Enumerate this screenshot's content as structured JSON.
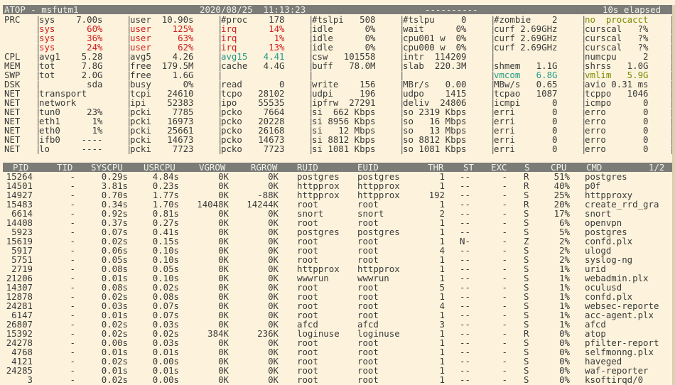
{
  "title": {
    "left": "ATOP - msfutm1",
    "datetime": "2020/08/25  11:13:23",
    "dashes": "----------",
    "elapsed": "10s elapsed"
  },
  "sys_rows": [
    [
      "PRC",
      "sys    7.00s",
      "user  10.90s",
      "#proc    178",
      "#tslpi   508",
      "#tslpu     0",
      "#zombie    2",
      "no  procacct"
    ],
    [
      "",
      "sys      60%",
      "user    125%",
      "irq      14%",
      "idle      0%",
      "wait      0%",
      "curf 2.69GHz",
      "curscal   ?%"
    ],
    [
      "",
      "sys      36%",
      "user     63%",
      "irq       1%",
      "idle      0%",
      "cpu001 w  0%",
      "curf 2.69GHz",
      "curscal   ?%"
    ],
    [
      "",
      "sys      24%",
      "user     62%",
      "irq      13%",
      "idle      0%",
      "cpu000 w  0%",
      "curf 2.69GHz",
      "curscal   ?%"
    ],
    [
      "CPL",
      "avg1    5.28",
      "avg5    4.26",
      "avg15   4.41",
      "csw   101558",
      "intr  114209",
      "",
      "numcpu     2"
    ],
    [
      "MEM",
      "tot     7.8G",
      "free  179.5M",
      "cache   4.4G",
      "buff   78.0M",
      "slab  220.3M",
      "shmem   1.1G",
      "shrss   1.0G"
    ],
    [
      "SWP",
      "tot     2.0G",
      "free    1.6G",
      "",
      "",
      "",
      "vmcom   6.8G",
      "vmlim   5.9G"
    ],
    [
      "DSK",
      "         sda",
      "busy      0%",
      "read       0",
      "write    156",
      "MBr/s   0.00",
      "MBw/s   0.65",
      "avio 0.31 ms"
    ],
    [
      "NET",
      "transport",
      "tcpi   24610",
      "tcpo   28102",
      "udpi     196",
      "udpo    1415",
      "tcpao   1087",
      "tcppo   1046"
    ],
    [
      "NET",
      "network",
      "ipi    52383",
      "ipo    55535",
      "ipfrw  27291",
      "deliv  24806",
      "icmpi      0",
      "icmpo      0"
    ],
    [
      "NET",
      "tun0     23%",
      "pcki    7785",
      "pcko    7664",
      "si  662 Kbps",
      "so 2319 Kbps",
      "erri       0",
      "erro       0"
    ],
    [
      "NET",
      "eth1      1%",
      "pcki   16973",
      "pcko   20228",
      "si 8956 Kbps",
      "so   16 Mbps",
      "erri       0",
      "erro       0"
    ],
    [
      "NET",
      "eth0      1%",
      "pcki   25661",
      "pcko   26168",
      "si   12 Mbps",
      "so   13 Mbps",
      "erri       0",
      "erro       0"
    ],
    [
      "NET",
      "ifb0    ----",
      "pcki   14673",
      "pcko   14673",
      "si 8812 Kbps",
      "so 8812 Kbps",
      "erri       0",
      "erro       0"
    ],
    [
      "NET",
      "lo      ----",
      "pcki    7723",
      "pcko    7723",
      "si 1081 Kbps",
      "so 1081 Kbps",
      "erri       0",
      "erro       0"
    ]
  ],
  "proc_header": [
    "PID",
    "TID",
    "SYSCPU",
    "USRCPU",
    "VGROW",
    "RGROW",
    "RUID",
    "EUID",
    "THR",
    "ST",
    "EXC",
    "S",
    "CPU",
    "CMD",
    "1/2"
  ],
  "processes": [
    [
      "15264",
      "-",
      "0.29s",
      "4.84s",
      "0K",
      "0K",
      "postgres",
      "postgres",
      "1",
      "--",
      "-",
      "R",
      "51%",
      "postgres"
    ],
    [
      "14501",
      "-",
      "3.81s",
      "0.23s",
      "0K",
      "0K",
      "httpprox",
      "httpprox",
      "1",
      "--",
      "-",
      "R",
      "40%",
      "p0f"
    ],
    [
      "14927",
      "-",
      "0.70s",
      "1.77s",
      "0K",
      "-88K",
      "httpprox",
      "httpprox",
      "192",
      "--",
      "-",
      "S",
      "25%",
      "httpproxy"
    ],
    [
      "15483",
      "-",
      "0.34s",
      "1.70s",
      "14048K",
      "14244K",
      "root",
      "root",
      "1",
      "--",
      "-",
      "R",
      "20%",
      "create_rrd_gra"
    ],
    [
      "6614",
      "-",
      "0.92s",
      "0.81s",
      "0K",
      "0K",
      "snort",
      "snort",
      "2",
      "--",
      "-",
      "S",
      "17%",
      "snort"
    ],
    [
      "14408",
      "-",
      "0.37s",
      "0.27s",
      "0K",
      "0K",
      "root",
      "root",
      "1",
      "--",
      "-",
      "S",
      "6%",
      "openvpn"
    ],
    [
      "5923",
      "-",
      "0.07s",
      "0.41s",
      "0K",
      "0K",
      "postgres",
      "postgres",
      "1",
      "--",
      "-",
      "S",
      "5%",
      "postgres"
    ],
    [
      "15619",
      "-",
      "0.02s",
      "0.15s",
      "0K",
      "0K",
      "root",
      "root",
      "1",
      "N-",
      "-",
      "Z",
      "2%",
      "confd.plx"
    ],
    [
      "5917",
      "-",
      "0.06s",
      "0.10s",
      "0K",
      "0K",
      "root",
      "root",
      "4",
      "--",
      "-",
      "S",
      "2%",
      "ulogd"
    ],
    [
      "5751",
      "-",
      "0.05s",
      "0.10s",
      "0K",
      "0K",
      "root",
      "root",
      "1",
      "--",
      "-",
      "S",
      "2%",
      "syslog-ng"
    ],
    [
      "2719",
      "-",
      "0.08s",
      "0.05s",
      "0K",
      "0K",
      "httpprox",
      "httpprox",
      "1",
      "--",
      "-",
      "S",
      "1%",
      "urid"
    ],
    [
      "21206",
      "-",
      "0.01s",
      "0.10s",
      "0K",
      "0K",
      "wwwrun",
      "wwwrun",
      "1",
      "--",
      "-",
      "S",
      "1%",
      "webadmin.plx"
    ],
    [
      "14307",
      "-",
      "0.08s",
      "0.02s",
      "0K",
      "0K",
      "root",
      "root",
      "5",
      "--",
      "-",
      "S",
      "1%",
      "oculusd"
    ],
    [
      "12878",
      "-",
      "0.02s",
      "0.08s",
      "0K",
      "0K",
      "root",
      "root",
      "1",
      "--",
      "-",
      "S",
      "1%",
      "confd.plx"
    ],
    [
      "24281",
      "-",
      "0.03s",
      "0.07s",
      "0K",
      "0K",
      "root",
      "root",
      "4",
      "--",
      "-",
      "S",
      "1%",
      "websec-reporte"
    ],
    [
      "6147",
      "-",
      "0.01s",
      "0.07s",
      "0K",
      "0K",
      "root",
      "root",
      "1",
      "--",
      "-",
      "S",
      "1%",
      "acc-agent.plx"
    ],
    [
      "26807",
      "-",
      "0.02s",
      "0.03s",
      "0K",
      "0K",
      "afcd",
      "afcd",
      "3",
      "--",
      "-",
      "S",
      "1%",
      "afcd"
    ],
    [
      "15392",
      "-",
      "0.02s",
      "0.02s",
      "384K",
      "236K",
      "loginuse",
      "loginuse",
      "1",
      "--",
      "-",
      "R",
      "0%",
      "atop"
    ],
    [
      "24278",
      "-",
      "0.00s",
      "0.03s",
      "0K",
      "0K",
      "root",
      "root",
      "1",
      "--",
      "-",
      "S",
      "0%",
      "pfilter-report"
    ],
    [
      "4768",
      "-",
      "0.01s",
      "0.01s",
      "0K",
      "0K",
      "root",
      "root",
      "1",
      "--",
      "-",
      "S",
      "0%",
      "selfmonng.plx"
    ],
    [
      "4121",
      "-",
      "0.02s",
      "0.00s",
      "0K",
      "0K",
      "root",
      "root",
      "1",
      "--",
      "-",
      "S",
      "0%",
      "haveged"
    ],
    [
      "24285",
      "-",
      "0.01s",
      "0.01s",
      "0K",
      "0K",
      "root",
      "root",
      "1",
      "--",
      "-",
      "S",
      "0%",
      "waf-reporter"
    ],
    [
      "3",
      "-",
      "0.02s",
      "0.00s",
      "0K",
      "0K",
      "root",
      "root",
      "1",
      "--",
      "-",
      "S",
      "0%",
      "ksoftirqd/0"
    ]
  ]
}
